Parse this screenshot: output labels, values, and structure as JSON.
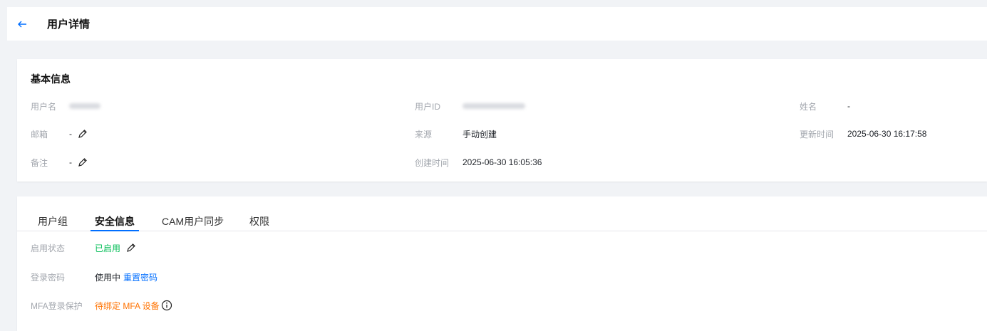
{
  "header": {
    "title": "用户详情"
  },
  "basic": {
    "title": "基本信息",
    "username": {
      "label": "用户名",
      "value": ""
    },
    "user_id": {
      "label": "用户ID",
      "value": ""
    },
    "name": {
      "label": "姓名",
      "value": "-"
    },
    "email": {
      "label": "邮箱",
      "value": "-"
    },
    "source": {
      "label": "来源",
      "value": "手动创建"
    },
    "updated": {
      "label": "更新时间",
      "value": "2025-06-30 16:17:58"
    },
    "remark": {
      "label": "备注",
      "value": "-"
    },
    "created": {
      "label": "创建时间",
      "value": "2025-06-30 16:05:36"
    }
  },
  "tabs": [
    {
      "label": "用户组"
    },
    {
      "label": "安全信息"
    },
    {
      "label": "CAM用户同步"
    },
    {
      "label": "权限"
    }
  ],
  "active_tab": "安全信息",
  "security": {
    "status": {
      "label": "启用状态",
      "value": "已启用"
    },
    "password": {
      "label": "登录密码",
      "value": "使用中",
      "action": "重置密码"
    },
    "mfa": {
      "label": "MFA登录保护",
      "value": "待绑定 MFA 设备"
    }
  },
  "colors": {
    "accent": "#006eff",
    "success": "#0abf5b",
    "warning": "#ff7200",
    "label": "#a3a7ae"
  },
  "icons": {
    "back": "arrow-left-icon",
    "edit": "pencil-icon",
    "info": "info-circle-icon"
  }
}
